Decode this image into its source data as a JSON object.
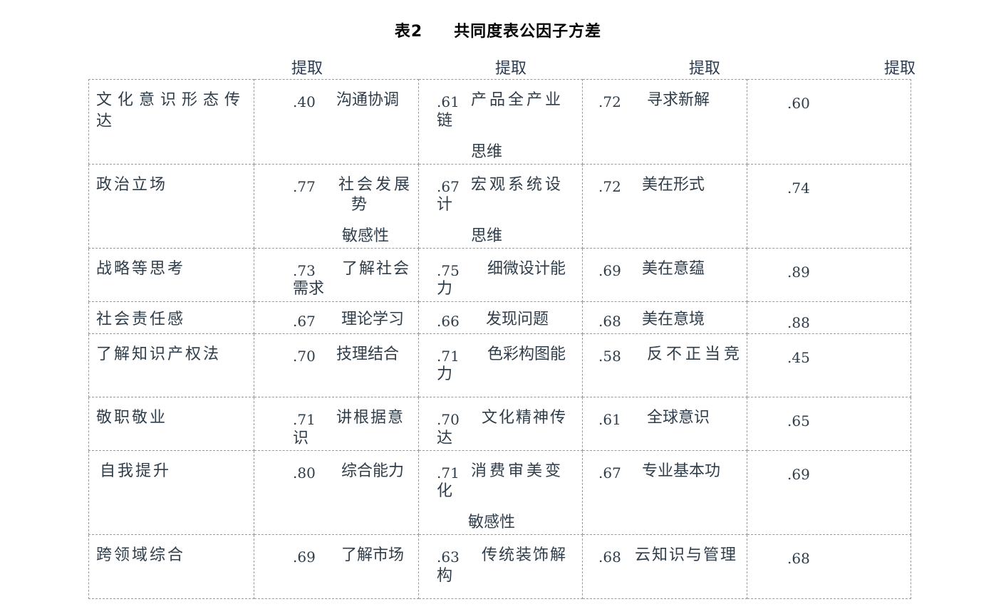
{
  "title": {
    "num": "表2",
    "text": "共同度表公因子方差"
  },
  "headers": [
    "提取",
    "提取",
    "提取",
    "提取"
  ],
  "rows": [
    {
      "c1": "文化意识形态传达",
      "v1": ".40",
      "c2": "沟通协调",
      "v2": ".61",
      "c3a": "产品全产业",
      "c3b": "链",
      "c3c": "思维",
      "v3": ".72",
      "c4": "寻求新解",
      "v4": ".60"
    },
    {
      "c1": "政治立场",
      "v1": ".77",
      "c2a": "社会发展",
      "c2b": "势",
      "c2c": "敏感性",
      "v2": ".67",
      "c3a": "宏观系统设",
      "c3b": "计",
      "c3c": "思维",
      "v3": ".72",
      "c4": "美在形式",
      "v4": ".74"
    },
    {
      "c1": "战略等思考",
      "v1": ".73",
      "c2a": "了解社会",
      "c2b": "需求",
      "v2": ".75",
      "c3a": "细微设计能",
      "c3b": "力",
      "v3": ".69",
      "c4": "美在意蕴",
      "v4": ".89"
    },
    {
      "c1": "社会责任感",
      "v1": ".67",
      "c2": "理论学习",
      "v2": ".66",
      "c3": "发现问题",
      "v3": ".68",
      "c4": "美在意境",
      "v4": ".88"
    },
    {
      "c1": "了解知识产权法",
      "v1": ".70",
      "c2": "技理结合",
      "v2": ".71",
      "c3a": "色彩构图能",
      "c3b": "力",
      "v3": ".58",
      "c4": "反不正当竞",
      "v4": ".45"
    },
    {
      "c1": "敬职敬业",
      "v1": ".71",
      "c2a": "讲根据意",
      "c2b": "识",
      "v2": ".70",
      "c3a": "文化精神传",
      "c3b": "达",
      "v3": ".61",
      "c4": "全球意识",
      "v4": ".65"
    },
    {
      "c1": "自我提升",
      "v1": ".80",
      "c2": "综合能力",
      "v2": ".71",
      "c3a": "消费审美变",
      "c3b": "化",
      "c3c": "敏感性",
      "v3": ".67",
      "c4": "专业基本功",
      "v4": ".69"
    },
    {
      "c1": "跨领域综合",
      "v1": ".69",
      "c2": "了解市场",
      "v2": ".63",
      "c3a": "传统装饰解",
      "c3b": "构",
      "v3": ".68",
      "c4": "云知识与管理",
      "v4": ".68"
    }
  ]
}
